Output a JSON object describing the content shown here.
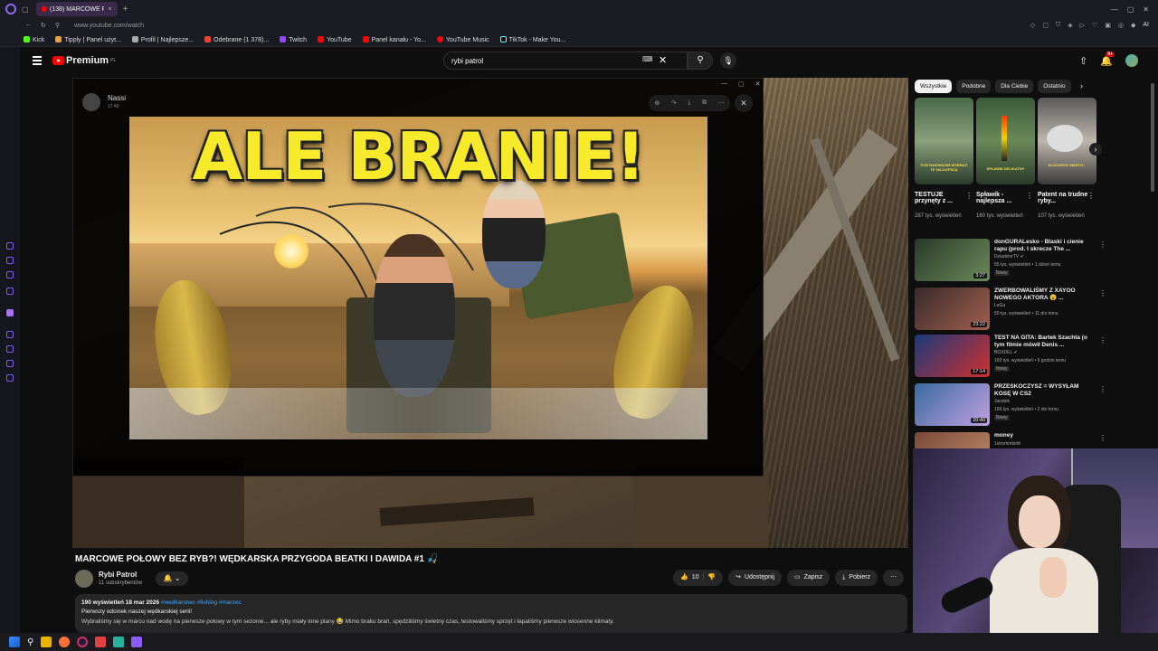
{
  "browser": {
    "tab_title": "(138) MARCOWE POŁOW...",
    "new_tab": "+",
    "url": "www.youtube.com/watch",
    "ext_ai": "AI",
    "bookmarks": [
      "Kick",
      "Tipply | Panel użyt...",
      "Profil | Najlepsze...",
      "Odebrane (1 378)...",
      "Twitch",
      "YouTube",
      "Panel kanału - Yo...",
      "YouTube Music",
      "TikTok - Make You..."
    ]
  },
  "header": {
    "logo": "Premium",
    "logo_sup": "PL",
    "search_value": "rybi patrol",
    "notif_count": "9+"
  },
  "overlay": {
    "user": "Nassi",
    "time": "17:40"
  },
  "thumbnail": {
    "headline": "ALE BRANIE!"
  },
  "video": {
    "title": "MARCOWE POŁOWY BEZ RYB?! WĘDKARSKA PRZYGODA BEATKI I DAWIDA #1 🎣",
    "channel": "Rybi Patrol",
    "subscribers": "11 subskrybentów",
    "likes": "10",
    "share": "Udostępnij",
    "save": "Zapisz",
    "download": "Pobierz",
    "desc_views": "190 wyświetleń  18 mar 2026",
    "desc_tags": "#wedkarstwo #fishing #marzec",
    "desc_line": "Pierwszy odcinek naszej wędkarskiej serii!",
    "desc_more": "Wybraliśmy się w marcu nad wodę na pierwsze połowy w tym sezonie... ale ryby miały inne plany 😂 Mimo braku brań, spędziliśmy świetny czas, testowaliśmy sprzęt i łapaliśmy pierwsze wiosenne klimaty."
  },
  "sidebar": {
    "chips": [
      "Wszystkie",
      "Podobne",
      "Dla Ciebie",
      "Ostatnio"
    ],
    "shorts": [
      {
        "title": "TESTUJE przynęty z ...",
        "views": "287 tys. wyświetleń",
        "caption": "POSTANOWILEM WYBRAĆ TE NAJLEPSZĄ"
      },
      {
        "title": "Spławik - najlepsza ...",
        "views": "160 tys. wyświetleń",
        "caption": "SPŁAWIK DELIKATNY"
      },
      {
        "title": "Patent na trudne ryby...",
        "views": "107 tys. wyświetleń",
        "caption": "DLACZEGO WARTO..."
      }
    ],
    "recs": [
      {
        "title": "donGURALesko - Blaski i cienie rapu (prod. I skrecze  The ...",
        "channel": "DziadziorTV ✔",
        "meta": "55 tys. wyświetleń • 1 dzień temu",
        "badge": "Nowy",
        "duration": "3:27",
        "colors": [
          "#2a3a2a",
          "#6a8a5a"
        ]
      },
      {
        "title": "ZWERBOWALIŚMY Z XAYOO NOWEGO AKTORA 😮 ...",
        "channel": "LeGu",
        "meta": "50 tys. wyświetleń • 11 dni temu",
        "badge": "",
        "duration": "23:22",
        "colors": [
          "#3a2a2a",
          "#a06050"
        ]
      },
      {
        "title": "TEST NA GITA: Bartek Szachta (o tym filmie mówił Denis ...",
        "channel": "BOXDEL ✔",
        "meta": "163 tys. wyświetleń • 5 godzin temu",
        "badge": "Nowy",
        "duration": "17:14",
        "colors": [
          "#1a3a7a",
          "#d03030"
        ]
      },
      {
        "title": "PRZESKOCZYSZ = WYSYŁAM KOSĘ W CS2",
        "channel": "Jacobik",
        "meta": "169 tys. wyświetleń • 2 dni temu",
        "badge": "Nowy",
        "duration": "20:40",
        "colors": [
          "#3a6aa0",
          "#c0a0e0"
        ]
      },
      {
        "title": "money",
        "channel": "1strommbirth",
        "meta": "",
        "badge": "",
        "duration": "",
        "colors": [
          "#7a4a3a",
          "#c08a6a"
        ]
      }
    ]
  }
}
